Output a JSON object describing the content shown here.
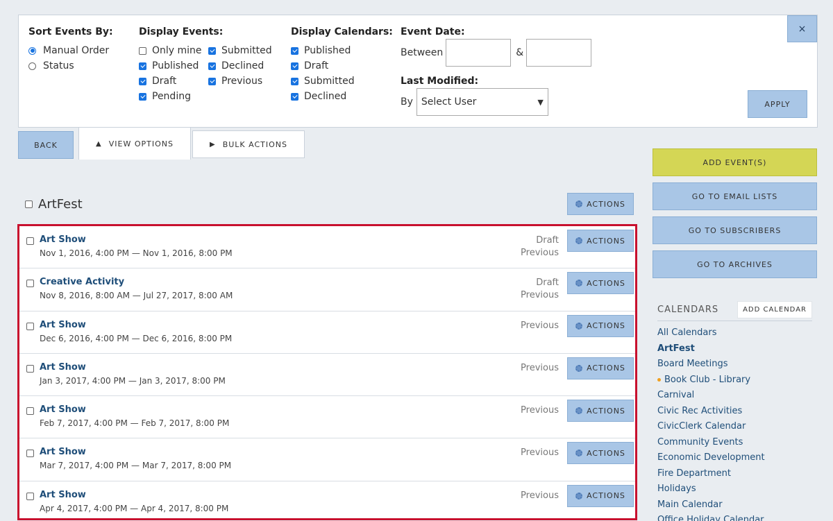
{
  "filters": {
    "close_label": "×",
    "sort": {
      "title": "Sort Events By:",
      "options": [
        {
          "label": "Manual Order",
          "checked": true
        },
        {
          "label": "Status",
          "checked": false
        }
      ]
    },
    "display_events": {
      "title": "Display Events:",
      "options": [
        {
          "label": "Only mine",
          "checked": false
        },
        {
          "label": "Submitted",
          "checked": true
        },
        {
          "label": "Published",
          "checked": true
        },
        {
          "label": "Declined",
          "checked": true
        },
        {
          "label": "Draft",
          "checked": true
        },
        {
          "label": "Previous",
          "checked": true
        },
        {
          "label": "Pending",
          "checked": true
        }
      ]
    },
    "display_calendars": {
      "title": "Display Calendars:",
      "options": [
        {
          "label": "Published",
          "checked": true
        },
        {
          "label": "Draft",
          "checked": true
        },
        {
          "label": "Submitted",
          "checked": true
        },
        {
          "label": "Declined",
          "checked": true
        }
      ]
    },
    "event_date": {
      "title": "Event Date:",
      "between_label": "Between",
      "and_label": "&",
      "from_value": "",
      "to_value": ""
    },
    "last_modified": {
      "title": "Last Modified:",
      "by_label": "By",
      "selected_user": "Select User"
    },
    "apply_label": "APPLY"
  },
  "tabs": {
    "back": "BACK",
    "view_options": "VIEW OPTIONS",
    "view_options_icon": "▲",
    "bulk_actions": "BULK ACTIONS",
    "bulk_actions_icon": "▶"
  },
  "group": {
    "title": "ArtFest",
    "actions_label": "ACTIONS"
  },
  "events": [
    {
      "title": "Art Show",
      "date": "Nov 1, 2016, 4:00 PM  —  Nov 1, 2016, 8:00 PM",
      "status": [
        "Draft",
        "Previous"
      ],
      "actions": "ACTIONS"
    },
    {
      "title": "Creative Activity",
      "date": "Nov 8, 2016, 8:00 AM  —  Jul 27, 2017, 8:00 AM",
      "status": [
        "Draft",
        "Previous"
      ],
      "actions": "ACTIONS"
    },
    {
      "title": "Art Show",
      "date": "Dec 6, 2016, 4:00 PM  —  Dec 6, 2016, 8:00 PM",
      "status": [
        "Previous"
      ],
      "actions": "ACTIONS"
    },
    {
      "title": "Art Show",
      "date": "Jan 3, 2017, 4:00 PM  —  Jan 3, 2017, 8:00 PM",
      "status": [
        "Previous"
      ],
      "actions": "ACTIONS"
    },
    {
      "title": "Art Show",
      "date": "Feb 7, 2017, 4:00 PM  —  Feb 7, 2017, 8:00 PM",
      "status": [
        "Previous"
      ],
      "actions": "ACTIONS"
    },
    {
      "title": "Art Show",
      "date": "Mar 7, 2017, 4:00 PM  —  Mar 7, 2017, 8:00 PM",
      "status": [
        "Previous"
      ],
      "actions": "ACTIONS"
    },
    {
      "title": "Art Show",
      "date": "Apr 4, 2017, 4:00 PM  —  Apr 4, 2017, 8:00 PM",
      "status": [
        "Previous"
      ],
      "actions": "ACTIONS"
    }
  ],
  "sidebar": {
    "add_events": "ADD EVENT(S)",
    "email_lists": "GO TO EMAIL LISTS",
    "subscribers": "GO TO SUBSCRIBERS",
    "archives": "GO TO ARCHIVES",
    "calendars_title": "CALENDARS",
    "add_calendar": "ADD CALENDAR",
    "calendars": [
      {
        "label": "All Calendars",
        "active": false,
        "dot": false
      },
      {
        "label": "ArtFest",
        "active": true,
        "dot": false
      },
      {
        "label": "Board Meetings",
        "active": false,
        "dot": false
      },
      {
        "label": "Book Club - Library",
        "active": false,
        "dot": true
      },
      {
        "label": "Carnival",
        "active": false,
        "dot": false
      },
      {
        "label": "Civic Rec Activities",
        "active": false,
        "dot": false
      },
      {
        "label": "CivicClerk Calendar",
        "active": false,
        "dot": false
      },
      {
        "label": "Community Events",
        "active": false,
        "dot": false
      },
      {
        "label": "Economic Development",
        "active": false,
        "dot": false
      },
      {
        "label": "Fire Department",
        "active": false,
        "dot": false
      },
      {
        "label": "Holidays",
        "active": false,
        "dot": false
      },
      {
        "label": "Main Calendar",
        "active": false,
        "dot": false
      },
      {
        "label": "Office Holiday Calendar",
        "active": false,
        "dot": false
      }
    ]
  },
  "colors": {
    "accent_blue": "#a9c6e6",
    "add_yellow": "#d4d655",
    "highlight_red": "#c8102e",
    "link_blue": "#1f4e79"
  }
}
